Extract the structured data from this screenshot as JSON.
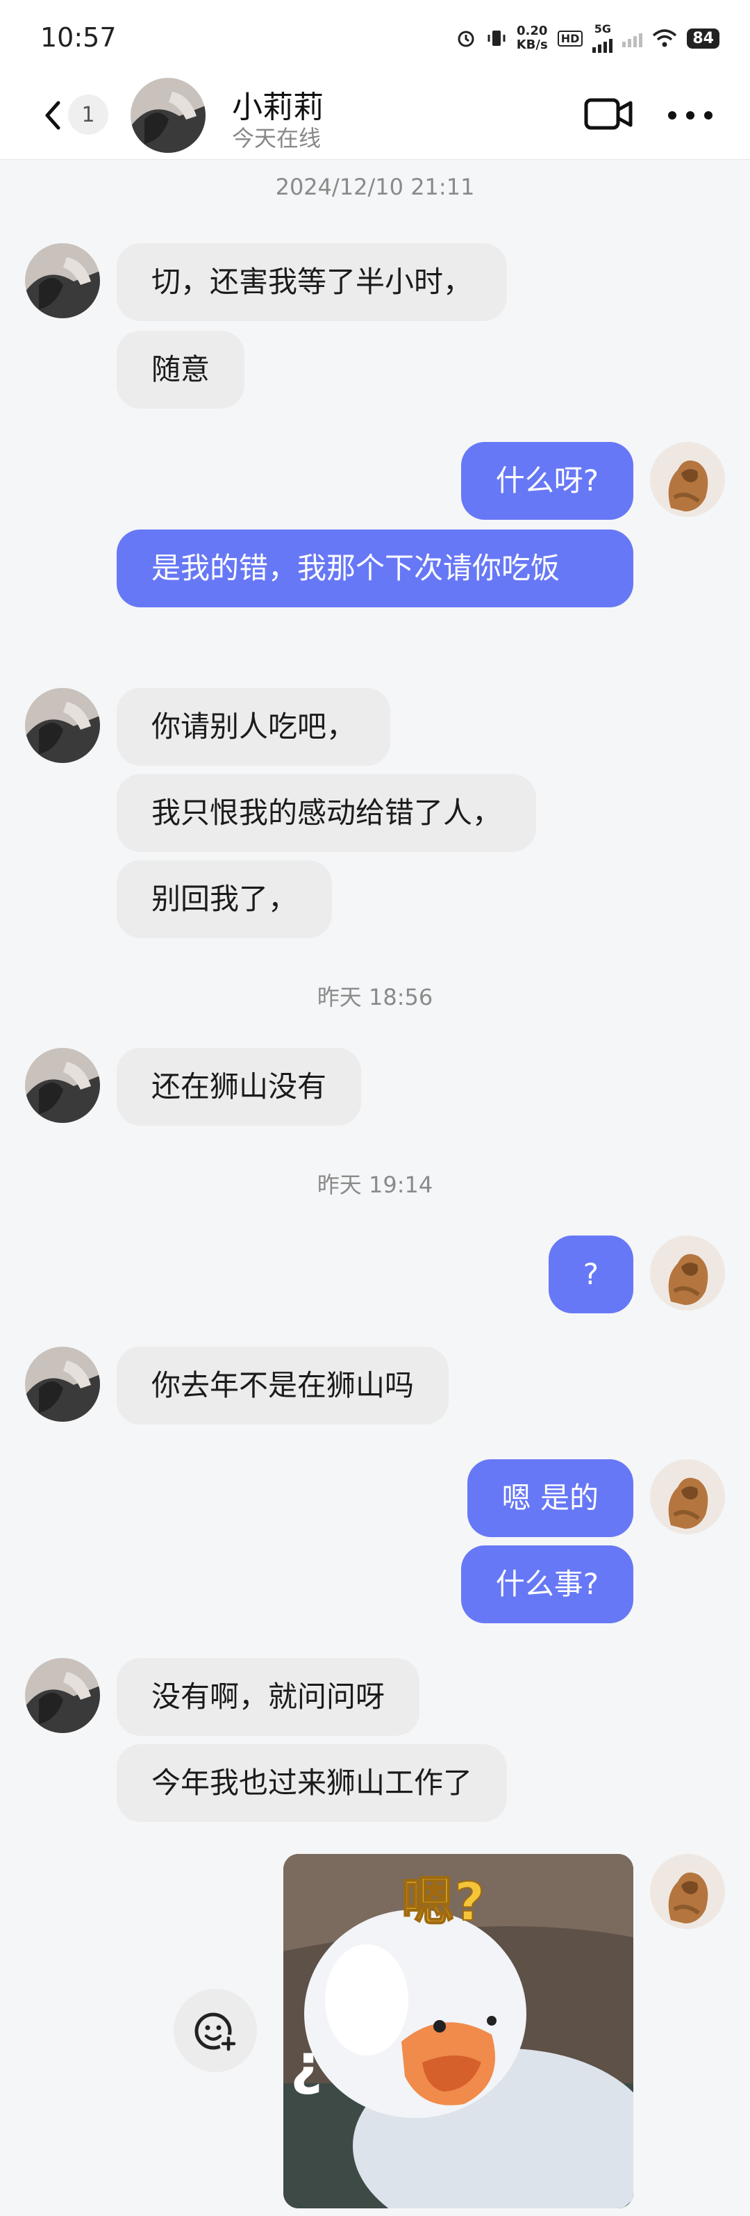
{
  "status_bar": {
    "time": "10:57",
    "net_speed_value": "0.20",
    "net_speed_unit": "KB/s",
    "hd_label": "HD",
    "network": "5G",
    "battery": "84"
  },
  "header": {
    "unread_count": "1",
    "contact_name": "小莉莉",
    "contact_status": "今天在线"
  },
  "timestamps": {
    "t1": "2024/12/10 21:11",
    "t2": "昨天 18:56",
    "t3": "昨天 19:14"
  },
  "messages": [
    {
      "dir": "in",
      "text": "切，还害我等了半小时，"
    },
    {
      "dir": "in",
      "text": "随意"
    },
    {
      "dir": "out",
      "text": "什么呀?"
    },
    {
      "dir": "out",
      "text": "是我的错，我那个下次请你吃饭"
    },
    {
      "dir": "in",
      "text": "你请别人吃吧，"
    },
    {
      "dir": "in",
      "text": "我只恨我的感动给错了人，"
    },
    {
      "dir": "in",
      "text": "别回我了，"
    },
    {
      "dir": "in",
      "text": "还在狮山没有"
    },
    {
      "dir": "out",
      "text": "?"
    },
    {
      "dir": "in",
      "text": "你去年不是在狮山吗"
    },
    {
      "dir": "out",
      "text": "嗯 是的"
    },
    {
      "dir": "out",
      "text": "什么事?"
    },
    {
      "dir": "in",
      "text": "没有啊，就问问呀"
    },
    {
      "dir": "in",
      "text": "今年我也过来狮山工作了"
    }
  ],
  "sticker": {
    "caption_top": "嗯?",
    "caption_side": "¿"
  },
  "colors": {
    "outgoing_bubble": "#6778f6",
    "incoming_bubble": "#ececec",
    "background": "#f5f6f7"
  },
  "icons": {
    "back": "chevron-left-icon",
    "video": "video-call-icon",
    "more": "more-dots-icon",
    "emoji_add": "emoji-add-icon"
  }
}
